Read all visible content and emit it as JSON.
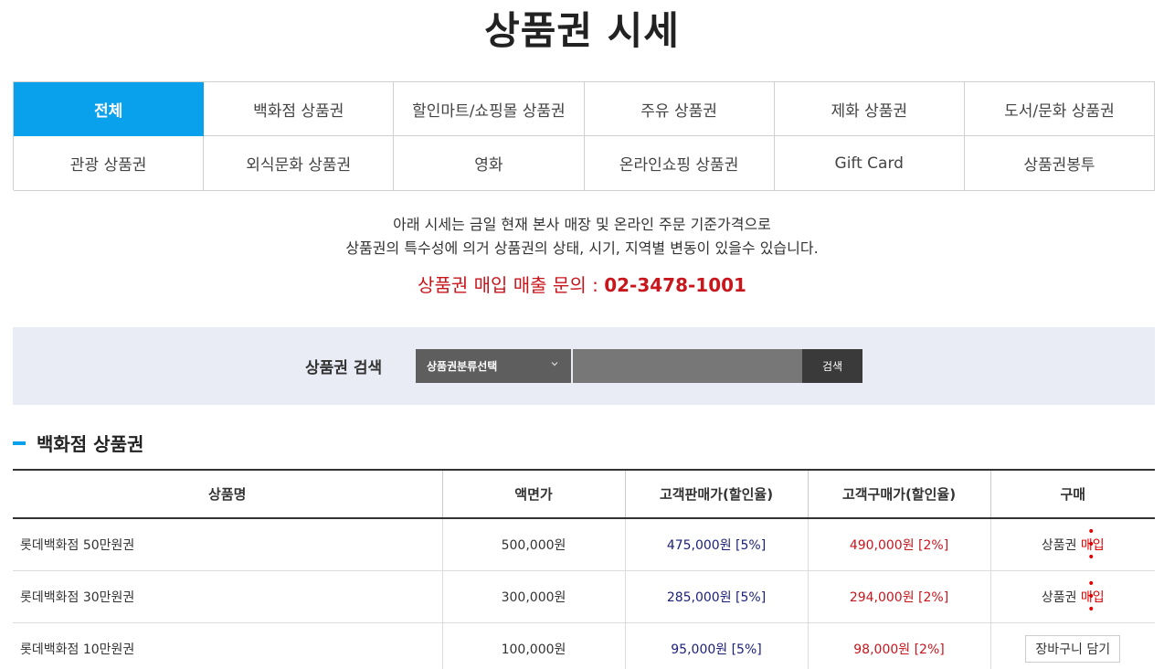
{
  "title": "상품권 시세",
  "tabs": [
    {
      "label": "전체",
      "active": true
    },
    {
      "label": "백화점 상품권"
    },
    {
      "label": "할인마트/쇼핑몰 상품권"
    },
    {
      "label": "주유 상품권"
    },
    {
      "label": "제화 상품권"
    },
    {
      "label": "도서/문화 상품권"
    },
    {
      "label": "관광 상품권"
    },
    {
      "label": "외식문화 상품권"
    },
    {
      "label": "영화"
    },
    {
      "label": "온라인쇼핑 상품권"
    },
    {
      "label": "Gift Card"
    },
    {
      "label": "상품권봉투"
    }
  ],
  "notice": {
    "line1": "아래 시세는 금일 현재 본사 매장 및 온라인 주문 기준가격으로",
    "line2": "상품권의 특수성에 의거 상품권의 상태, 시기, 지역별 변동이 있을수 있습니다.",
    "inquiry_label": "상품권 매입 매출 문의 : ",
    "inquiry_phone": "02-3478-1001"
  },
  "search": {
    "label": "상품권 검색",
    "select_value": "상품권분류선택",
    "input_value": "",
    "button_label": "검색"
  },
  "section": {
    "title": "백화점 상품권"
  },
  "table": {
    "headers": [
      "상품명",
      "액면가",
      "고객판매가(할인율)",
      "고객구매가(할인율)",
      "구매"
    ],
    "rows": [
      {
        "name": "롯데백화점 50만원권",
        "face": "500,000원",
        "sell": "475,000원 [5%]",
        "buy": "490,000원 [2%]",
        "action_prefix": "상품권 ",
        "action_em": "매입",
        "action_dots": "• • •"
      },
      {
        "name": "롯데백화점 30만원권",
        "face": "300,000원",
        "sell": "285,000원 [5%]",
        "buy": "294,000원 [2%]",
        "action_prefix": "상품권 ",
        "action_em": "매입",
        "action_dots": "• • •"
      },
      {
        "name": "롯데백화점 10만원권",
        "face": "100,000원",
        "sell": "95,000원 [5%]",
        "buy": "98,000원 [2%]",
        "action_button": "장바구니 담기"
      }
    ]
  },
  "colors": {
    "accent": "#0aa1ec",
    "inquiry_red": "#c8161d",
    "sell_blue": "#1a1f7a",
    "search_bg": "#e9ecf4"
  },
  "icons": {
    "select_chevron": "chevron-down-icon"
  }
}
